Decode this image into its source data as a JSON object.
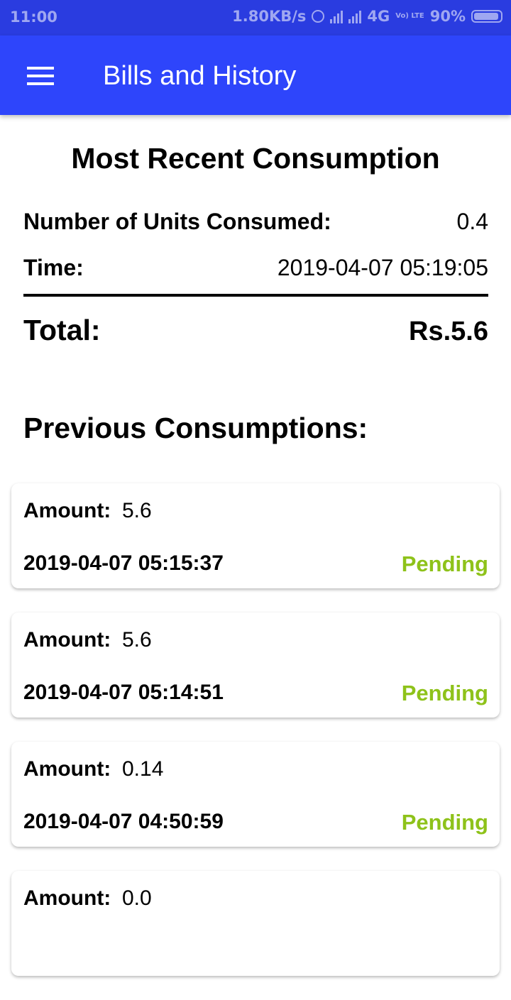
{
  "status_bar": {
    "time": "11:00",
    "net_speed": "1.80KB/s",
    "network": "4G",
    "volte": "Vo) LTE",
    "battery": "90%"
  },
  "toolbar": {
    "title": "Bills and History",
    "menu_icon": "hamburger-menu-icon"
  },
  "recent": {
    "title": "Most Recent Consumption",
    "units_label": "Number of Units Consumed:",
    "units_value": "0.4",
    "time_label": "Time:",
    "time_value": "2019-04-07 05:19:05",
    "total_label": "Total:",
    "total_value": "Rs.5.6"
  },
  "previous": {
    "title": "Previous Consumptions:",
    "items": [
      {
        "amount_label": "Amount:",
        "amount": "5.6",
        "date": "2019-04-07 05:15:37",
        "status": "Pending"
      },
      {
        "amount_label": "Amount:",
        "amount": "5.6",
        "date": "2019-04-07 05:14:51",
        "status": "Pending"
      },
      {
        "amount_label": "Amount:",
        "amount": "0.14",
        "date": "2019-04-07 04:50:59",
        "status": "Pending"
      },
      {
        "amount_label": "Amount:",
        "amount": "0.0",
        "date": "",
        "status": ""
      }
    ]
  },
  "colors": {
    "toolbar": "#2e45fb",
    "status_bar": "#2a3ce0",
    "pending": "#8ec21a"
  }
}
